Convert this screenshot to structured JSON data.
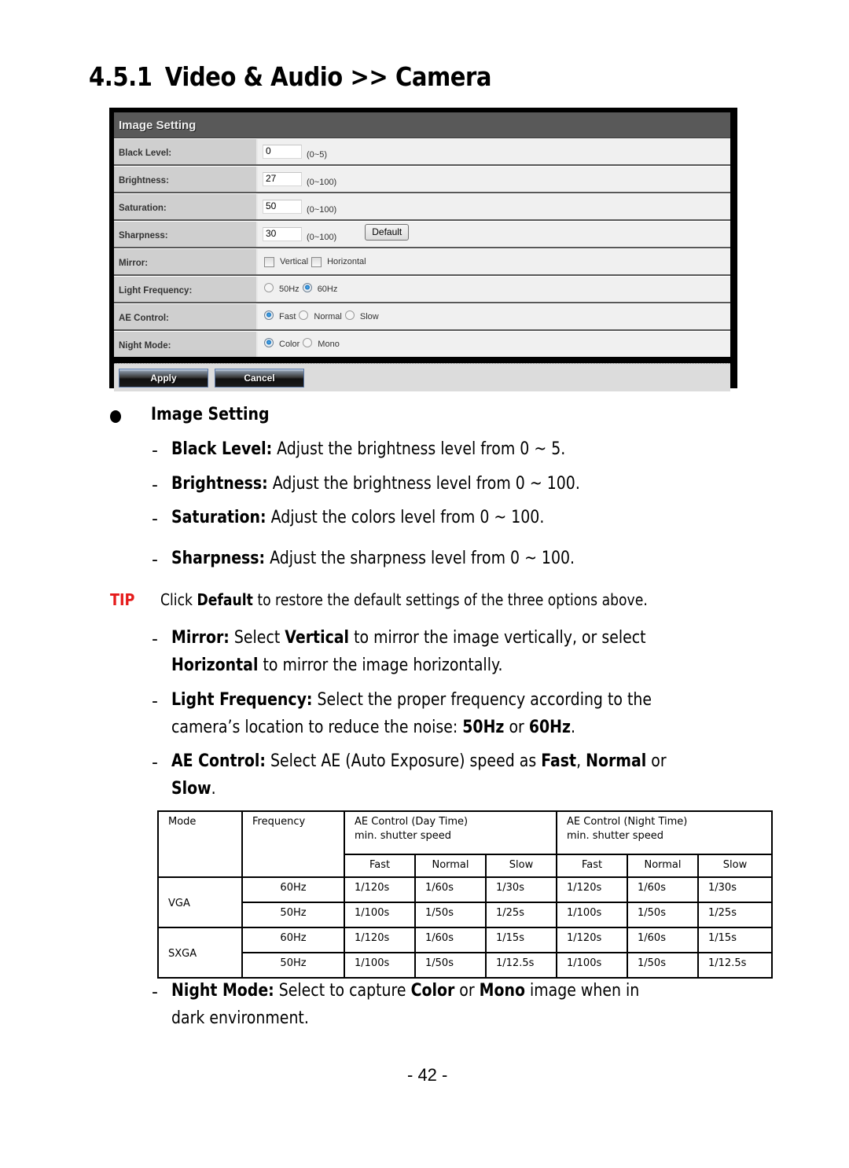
{
  "heading": {
    "number": "4.5.1",
    "title": "Video & Audio >> Camera"
  },
  "panel": {
    "title": "Image Setting",
    "rows": {
      "black_level": {
        "label": "Black Level:",
        "value": "0",
        "range": "(0~5)"
      },
      "brightness": {
        "label": "Brightness:",
        "value": "27",
        "range": "(0~100)"
      },
      "saturation": {
        "label": "Saturation:",
        "value": "50",
        "range": "(0~100)"
      },
      "sharpness": {
        "label": "Sharpness:",
        "value": "30",
        "range": "(0~100)",
        "default_button": "Default"
      },
      "mirror": {
        "label": "Mirror:",
        "options": [
          "Vertical",
          "Horizontal"
        ],
        "checked": []
      },
      "light_frequency": {
        "label": "Light Frequency:",
        "options": [
          "50Hz",
          "60Hz"
        ],
        "selected": "60Hz"
      },
      "ae_control": {
        "label": "AE Control:",
        "options": [
          "Fast",
          "Normal",
          "Slow"
        ],
        "selected": "Fast"
      },
      "night_mode": {
        "label": "Night Mode:",
        "options": [
          "Color",
          "Mono"
        ],
        "selected": "Color"
      }
    },
    "apply_label": "Apply",
    "cancel_label": "Cancel"
  },
  "section": {
    "title": "Image Setting",
    "items": {
      "black_level": {
        "term": "Black Level:",
        "text": " Adjust the brightness level from 0 ~ 5."
      },
      "brightness": {
        "term": "Brightness:",
        "text": " Adjust the brightness level from 0 ~ 100."
      },
      "saturation": {
        "term": "Saturation:",
        "text": " Adjust the colors level from 0 ~ 100."
      },
      "sharpness": {
        "term": "Sharpness:",
        "text": " Adjust the sharpness level from 0 ~ 100."
      }
    },
    "tip": {
      "label": "TIP",
      "pre": "Click ",
      "bold": "Default",
      "post": " to restore the default settings of the three options above."
    },
    "mirror": {
      "term": "Mirror:",
      "t1": " Select ",
      "b1": "Vertical",
      "t2": " to mirror the image vertically, or select",
      "b2": "Horizontal",
      "t3": " to mirror the image horizontally."
    },
    "light_frequency": {
      "term": "Light Frequency:",
      "t1": " Select the proper frequency according to the",
      "t2": "camera’s location to reduce the noise: ",
      "b1": "50Hz",
      "t3": " or ",
      "b2": "60Hz",
      "t4": "."
    },
    "ae_control": {
      "term": "AE Control:",
      "t1": " Select AE (Auto Exposure) speed as ",
      "b1": "Fast",
      "t2": ", ",
      "b2": "Normal",
      "t3": " or",
      "b3": "Slow",
      "t4": "."
    },
    "night_mode": {
      "term": "Night Mode:",
      "t1": " Select to capture ",
      "b1": "Color",
      "t2": " or ",
      "b2": "Mono",
      "t3": " image when in",
      "t4": "dark environment."
    }
  },
  "ae_table": {
    "headers": {
      "mode": "Mode",
      "frequency": "Frequency",
      "day": "AE Control (Day Time)",
      "night": "AE Control (Night Time)",
      "sub": "min. shutter speed",
      "speeds": [
        "Fast",
        "Normal",
        "Slow"
      ]
    },
    "rows": [
      {
        "mode": "VGA",
        "freq": "60Hz",
        "day": [
          "1/120s",
          "1/60s",
          "1/30s"
        ],
        "night": [
          "1/120s",
          "1/60s",
          "1/30s"
        ]
      },
      {
        "mode": "VGA",
        "freq": "50Hz",
        "day": [
          "1/100s",
          "1/50s",
          "1/25s"
        ],
        "night": [
          "1/100s",
          "1/50s",
          "1/25s"
        ]
      },
      {
        "mode": "SXGA",
        "freq": "60Hz",
        "day": [
          "1/120s",
          "1/60s",
          "1/15s"
        ],
        "night": [
          "1/120s",
          "1/60s",
          "1/15s"
        ]
      },
      {
        "mode": "SXGA",
        "freq": "50Hz",
        "day": [
          "1/100s",
          "1/50s",
          "1/12.5s"
        ],
        "night": [
          "1/100s",
          "1/50s",
          "1/12.5s"
        ]
      }
    ]
  },
  "page_number": "- 42 -",
  "colors": {
    "tip": "#e51b1b",
    "panel_header": "#595959",
    "label_bg": "#cfcfcf",
    "value_bg": "#f0f0f0"
  }
}
